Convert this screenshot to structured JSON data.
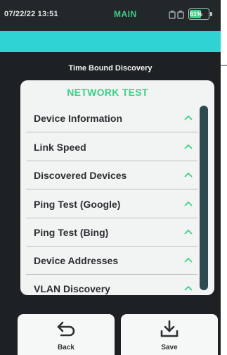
{
  "status": {
    "datetime": "07/22/22 13:51",
    "mode": "MAIN",
    "battery": "61%",
    "battery_level": 0.61
  },
  "screen": {
    "title": "Time Bound Discovery"
  },
  "panel": {
    "title": "NETWORK TEST",
    "items": [
      {
        "label": "Device Information"
      },
      {
        "label": "Link Speed"
      },
      {
        "label": "Discovered Devices"
      },
      {
        "label": "Ping Test (Google)"
      },
      {
        "label": "Ping Test (Bing)"
      },
      {
        "label": "Device Addresses"
      },
      {
        "label": "VLAN Discovery"
      }
    ]
  },
  "buttons": {
    "back": "Back",
    "save": "Save"
  },
  "colors": {
    "accent_green": "#3fcf87",
    "teal": "#2fd3d1",
    "background": "#1d2123"
  },
  "icons": {
    "network": "ethernet-ports-icon",
    "chevron": "chevron-up-icon",
    "back": "back-arrow-icon",
    "save": "download-icon"
  }
}
